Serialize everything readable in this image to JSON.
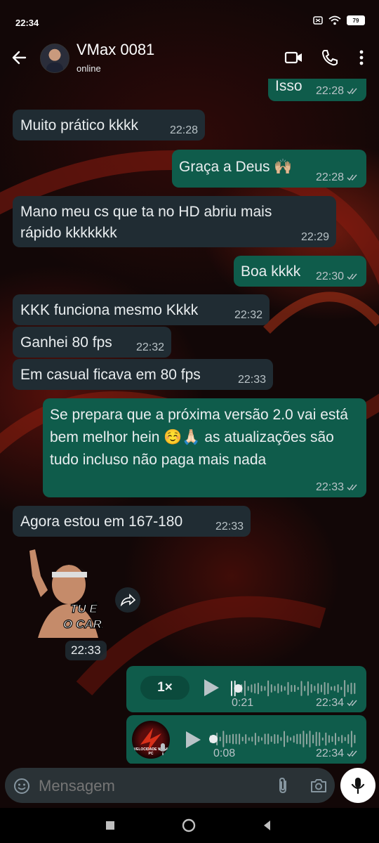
{
  "status_bar": {
    "time": "22:34",
    "battery": "79"
  },
  "header": {
    "contact_name": "VMax 0081",
    "contact_status": "online"
  },
  "messages": [
    {
      "type": "outgoing",
      "text": "Isso",
      "time": "22:28"
    },
    {
      "type": "incoming",
      "text": "Muito prático kkkk",
      "time": "22:28"
    },
    {
      "type": "outgoing",
      "text": "Graça a Deus 🙌🏼",
      "time": "22:28"
    },
    {
      "type": "incoming",
      "text": "Mano meu cs que ta no HD abriu mais rápido kkkkkkk",
      "time": "22:29"
    },
    {
      "type": "outgoing",
      "text": "Boa kkkk",
      "time": "22:30"
    },
    {
      "type": "incoming",
      "text": "KKK funciona mesmo Kkkk",
      "time": "22:32"
    },
    {
      "type": "incoming",
      "text": "Ganhei 80 fps",
      "time": "22:32"
    },
    {
      "type": "incoming",
      "text": "Em casual ficava em 80 fps",
      "time": "22:33"
    },
    {
      "type": "outgoing",
      "text": "Se prepara que a próxima versão 2.0 vai está bem melhor hein ☺️🙏🏻 as atualizações são tudo incluso não paga mais nada",
      "time": "22:33"
    },
    {
      "type": "incoming",
      "text": "Agora estou em 167-180",
      "time": "22:33"
    }
  ],
  "sticker": {
    "caption_line1": "TU É",
    "caption_line2": "O CARA",
    "time": "22:33"
  },
  "audio_messages": [
    {
      "speed": "1×",
      "duration": "0:21",
      "time": "22:34",
      "progress": 0.03
    },
    {
      "duration": "0:08",
      "time": "22:34",
      "avatar_text": "VELOCIDADE VMAX PC",
      "progress": 0.0
    }
  ],
  "composer": {
    "placeholder": "Mensagem"
  },
  "icons": [
    "back-arrow-icon",
    "video-call-icon",
    "phone-icon",
    "more-vert-icon",
    "emoji-icon",
    "attach-icon",
    "camera-icon",
    "mic-icon",
    "forward-icon",
    "play-icon",
    "double-check-icon"
  ],
  "colors": {
    "incoming_bubble": "#202c33",
    "outgoing_bubble": "#0f5c4b",
    "read_tick": "#b9c3c7"
  }
}
